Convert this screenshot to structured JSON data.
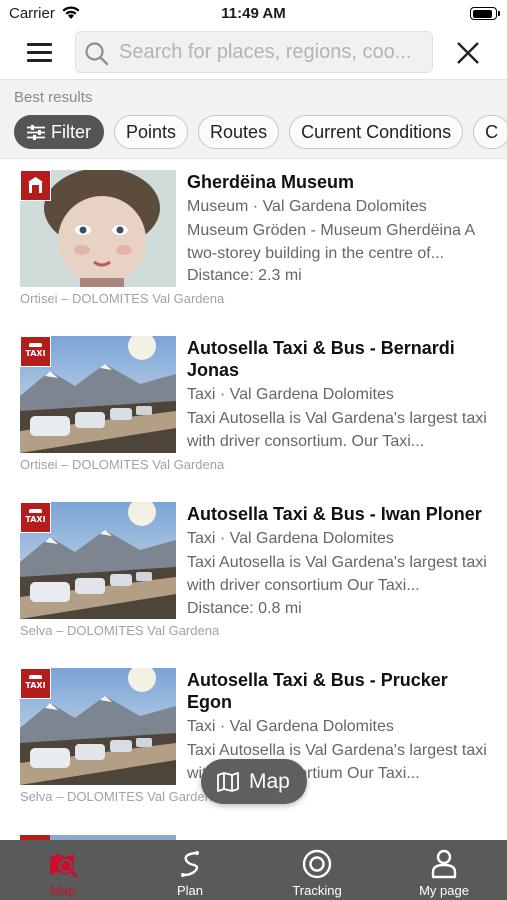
{
  "status_bar": {
    "carrier": "Carrier",
    "time": "11:49 AM"
  },
  "search": {
    "placeholder": "Search for places, regions, coo..."
  },
  "results": {
    "label": "Best results",
    "chips": [
      "Filter",
      "Points",
      "Routes",
      "Current Conditions",
      "C"
    ]
  },
  "items": [
    {
      "title": "Gherdëina Museum",
      "subtitle": "Museum · Val Gardena Dolomites",
      "description": "Museum Gröden - Museum Gherdëina A two-storey building in the centre of...",
      "distance": "Distance: 2.3 mi",
      "location": "Ortisei – DOLOMITES Val Gardena",
      "badge": "museum-icon"
    },
    {
      "title": "Autosella Taxi & Bus - Bernardi Jonas",
      "subtitle": "Taxi · Val Gardena Dolomites",
      "description": "Taxi Autosella is Val Gardena's largest taxi with driver consortium. Our Taxi...",
      "distance": "",
      "location": "Ortisei – DOLOMITES Val Gardena",
      "badge": "taxi-icon",
      "badge_text": "TAXI"
    },
    {
      "title": "Autosella Taxi & Bus - Iwan Ploner",
      "subtitle": "Taxi · Val Gardena Dolomites",
      "description": "Taxi Autosella is Val Gardena's largest taxi with driver consortium Our Taxi...",
      "distance": "Distance: 0.8 mi",
      "location": "Selva – DOLOMITES Val Gardena",
      "badge": "taxi-icon",
      "badge_text": "TAXI"
    },
    {
      "title": "Autosella Taxi & Bus - Prucker Egon",
      "subtitle": "Taxi · Val Gardena Dolomites",
      "description": "Taxi Autosella is Val Gardena's largest taxi with driver consortium Our Taxi...",
      "distance": "",
      "location": "Selva – DOLOMITES Val Gardena",
      "badge": "taxi-icon",
      "badge_text": "TAXI"
    }
  ],
  "map_button": {
    "label": "Map"
  },
  "tabs": [
    {
      "label": "Map",
      "icon": "map-search-icon",
      "active": true
    },
    {
      "label": "Plan",
      "icon": "route-plan-icon",
      "active": false
    },
    {
      "label": "Tracking",
      "icon": "tracking-icon",
      "active": false
    },
    {
      "label": "My page",
      "icon": "user-icon",
      "active": false
    }
  ],
  "colors": {
    "accent": "#c8102e",
    "badge": "#b51d1d",
    "tab_bar": "#5a5a5a",
    "chip_active": "#555555"
  }
}
